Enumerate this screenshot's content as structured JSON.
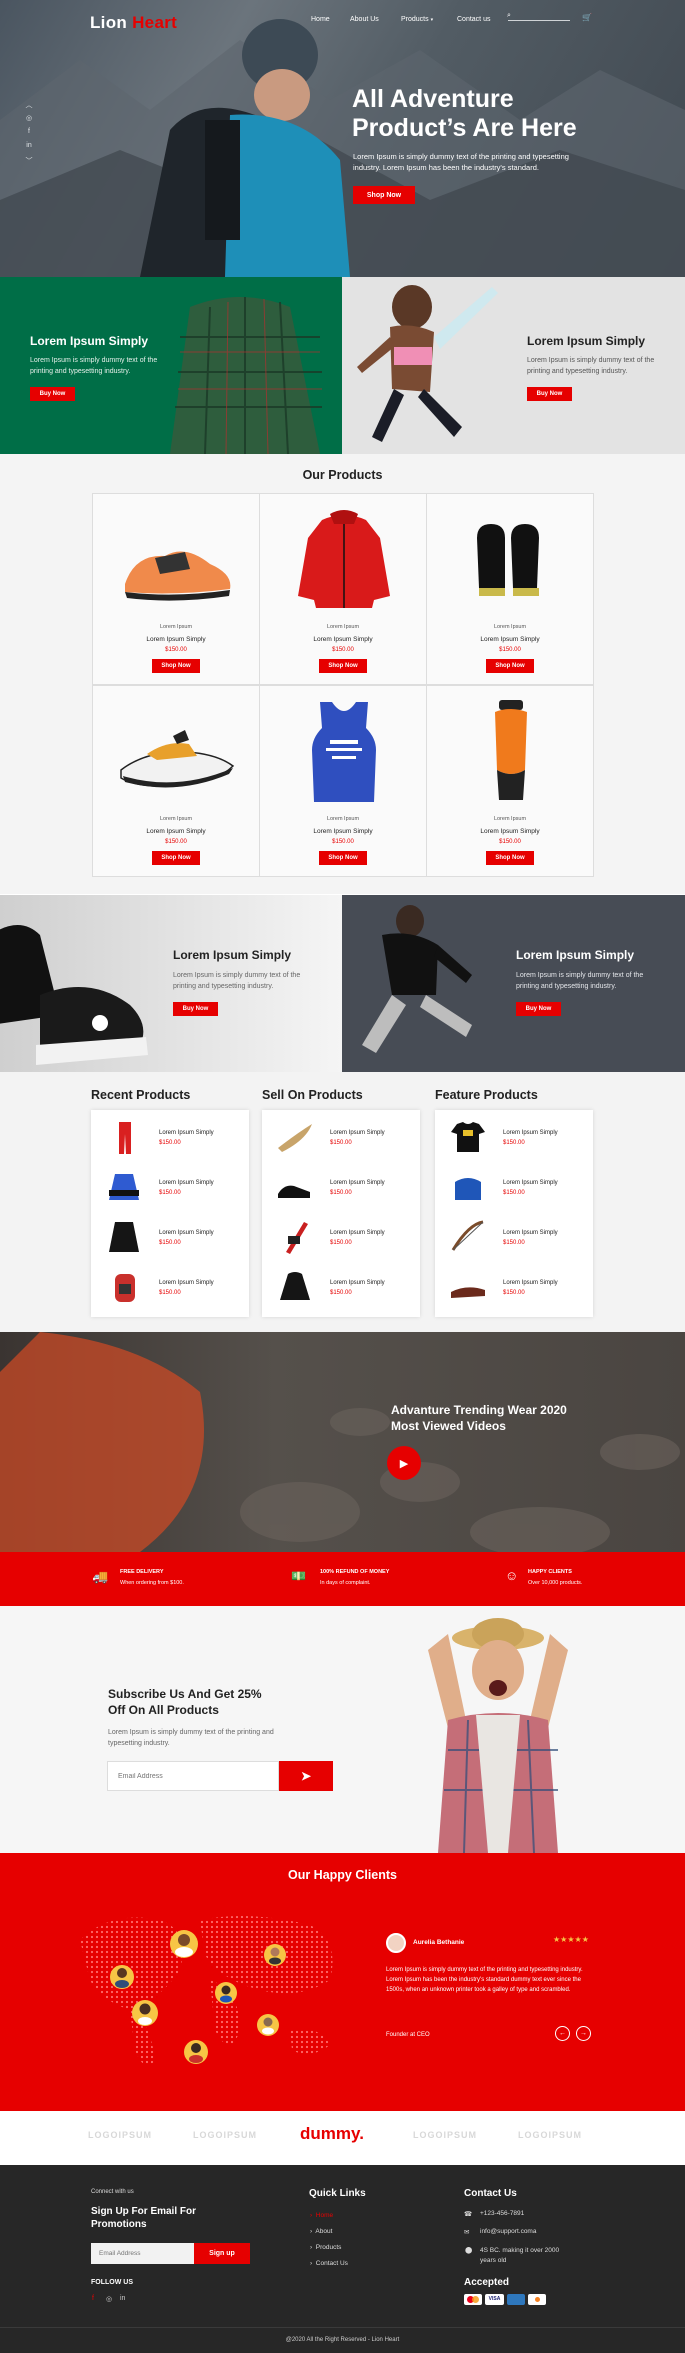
{
  "header": {
    "logo_a": "Lion",
    "logo_b": "Heart",
    "nav": [
      "Home",
      "About Us",
      "Products",
      "Contact us"
    ]
  },
  "hero": {
    "title": "All Adventure Product’s Are Here",
    "text": "Lorem Ipsum is simply dummy text of the printing and typesetting industry. Lorem Ipsum has been the industry's standard.",
    "button": "Shop Now"
  },
  "promo1": {
    "left": {
      "title": "Lorem Ipsum Simply",
      "text": "Lorem Ipsum is simply dummy text of the printing and typesetting industry.",
      "button": "Buy Now"
    },
    "right": {
      "title": "Lorem Ipsum Simply",
      "text": "Lorem Ipsum is simply dummy text of the printing and typesetting industry.",
      "button": "Buy Now"
    }
  },
  "products": {
    "title": "Our Products",
    "items": [
      {
        "cat": "Lorem Ipsum",
        "name": "Lorem Ipsum Simply",
        "price": "$150.00",
        "button": "Shop Now"
      },
      {
        "cat": "Lorem Ipsum",
        "name": "Lorem Ipsum Simply",
        "price": "$150.00",
        "button": "Shop Now"
      },
      {
        "cat": "Lorem Ipsum",
        "name": "Lorem Ipsum Simply",
        "price": "$150.00",
        "button": "Shop Now"
      },
      {
        "cat": "Lorem Ipsum",
        "name": "Lorem Ipsum Simply",
        "price": "$150.00",
        "button": "Shop Now"
      },
      {
        "cat": "Lorem Ipsum",
        "name": "Lorem Ipsum Simply",
        "price": "$150.00",
        "button": "Shop Now"
      },
      {
        "cat": "Lorem Ipsum",
        "name": "Lorem Ipsum Simply",
        "price": "$150.00",
        "button": "Shop Now"
      }
    ]
  },
  "promo2": {
    "left": {
      "title": "Lorem Ipsum Simply",
      "text": "Lorem Ipsum is simply dummy text of the printing and typesetting industry.",
      "button": "Buy Now"
    },
    "right": {
      "title": "Lorem Ipsum Simply",
      "text": "Lorem Ipsum is simply dummy text of the printing and typesetting industry.",
      "button": "Buy Now"
    }
  },
  "lists": [
    {
      "title": "Recent Products",
      "items": [
        {
          "name": "Lorem Ipsum Simply",
          "price": "$150.00"
        },
        {
          "name": "Lorem Ipsum Simply",
          "price": "$150.00"
        },
        {
          "name": "Lorem Ipsum Simply",
          "price": "$150.00"
        },
        {
          "name": "Lorem Ipsum Simply",
          "price": "$150.00"
        }
      ]
    },
    {
      "title": "Sell On Products",
      "items": [
        {
          "name": "Lorem Ipsum Simply",
          "price": "$150.00"
        },
        {
          "name": "Lorem Ipsum Simply",
          "price": "$150.00"
        },
        {
          "name": "Lorem Ipsum Simply",
          "price": "$150.00"
        },
        {
          "name": "Lorem Ipsum Simply",
          "price": "$150.00"
        }
      ]
    },
    {
      "title": "Feature Products",
      "items": [
        {
          "name": "Lorem Ipsum Simply",
          "price": "$150.00"
        },
        {
          "name": "Lorem Ipsum Simply",
          "price": "$150.00"
        },
        {
          "name": "Lorem Ipsum Simply",
          "price": "$150.00"
        },
        {
          "name": "Lorem Ipsum Simply",
          "price": "$150.00"
        }
      ]
    }
  ],
  "video": {
    "title": "Advanture Trending Wear 2020 Most Viewed Videos"
  },
  "features": [
    {
      "title": "FREE DELIVERY",
      "text": "When ordering from $100."
    },
    {
      "title": "100% REFUND OF MONEY",
      "text": "In days of complaint."
    },
    {
      "title": "HAPPY CLIENTS",
      "text": "Over 10,000 products."
    }
  ],
  "subscribe": {
    "title": "Subscribe Us And Get 25% Off On All Products",
    "text": "Lorem Ipsum is simply dummy text of the printing and typesetting industry.",
    "placeholder": "Email Address"
  },
  "clients": {
    "title": "Our Happy Clients",
    "name": "Aurelia Bethanie",
    "stars": "★★★★★",
    "quote": "Lorem Ipsum is simply dummy text of the printing and typesetting industry. Lorem Ipsum has been the industry's standard dummy text ever since the 1500s, when an unknown printer took a galley of type and scrambled.",
    "role": "Founder at CEO"
  },
  "brands": [
    "LOGOIPSUM",
    "LOGOIPSUM",
    "dummy.",
    "LOGOIPSUM",
    "LOGOIPSUM"
  ],
  "footer": {
    "connect": "Connect with us",
    "signup_title": "Sign Up For Email For Promotions",
    "placeholder": "Email Address",
    "signup_button": "Sign up",
    "follow": "FOLLOW US",
    "quick_title": "Quick Links",
    "links": [
      "Home",
      "About",
      "Products",
      "Contact Us"
    ],
    "contact_title": "Contact Us",
    "phone": "+123-456-7891",
    "email": "info@support.coma",
    "address": "4S BC. making it over 2000 years old",
    "accepted": "Accepted",
    "copyright": "@2020 All the Right Reserved - Lion Heart"
  }
}
